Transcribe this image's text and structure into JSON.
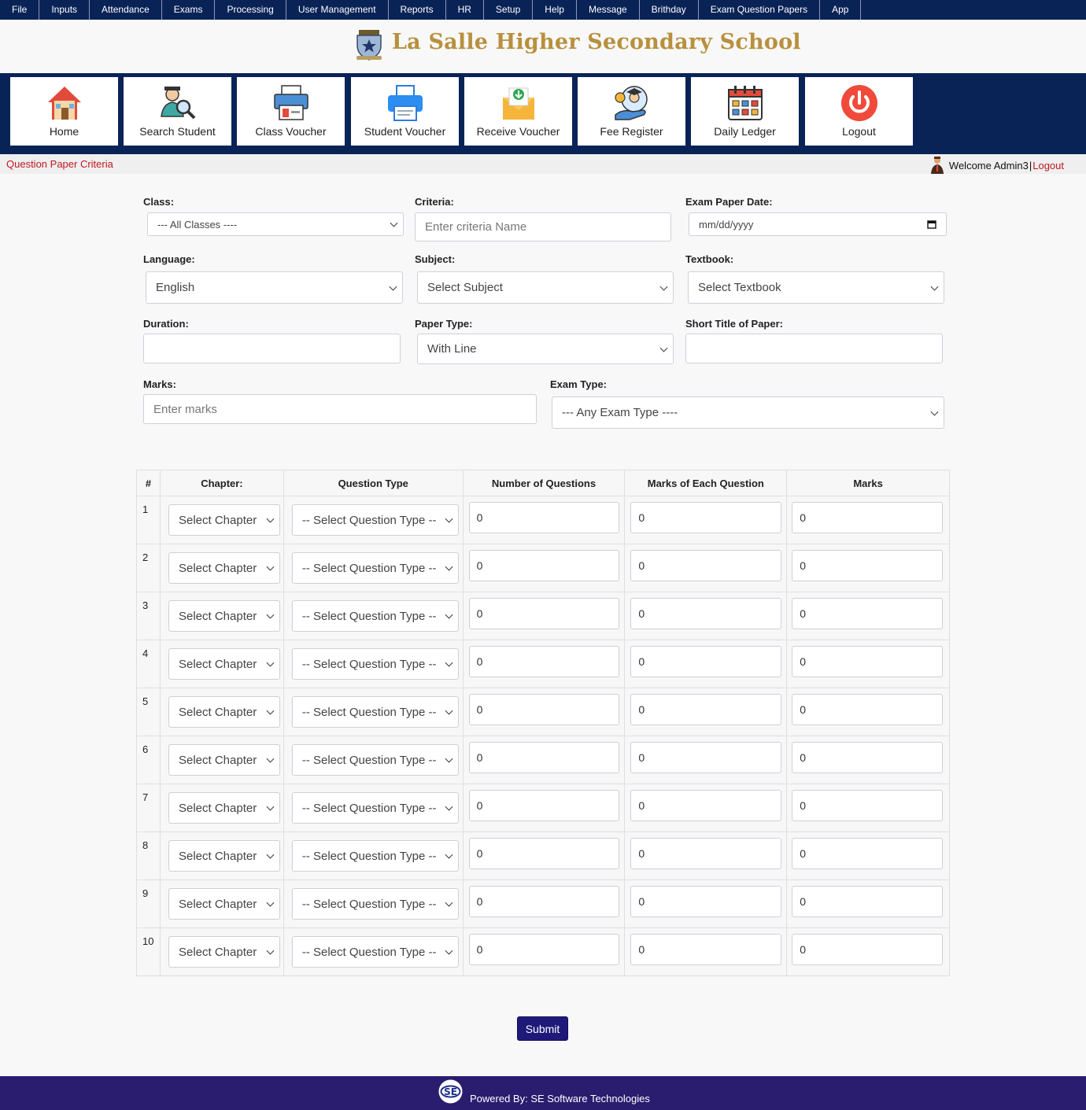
{
  "menu": [
    "File",
    "Inputs",
    "Attendance",
    "Exams",
    "Processing",
    "User Management",
    "Reports",
    "HR",
    "Setup",
    "Help",
    "Message",
    "Brithday",
    "Exam Question Papers",
    "App"
  ],
  "header": {
    "school_name": "La Salle Higher Secondary School"
  },
  "tiles": [
    {
      "label": "Home",
      "icon": "home-icon"
    },
    {
      "label": "Search Student",
      "icon": "search-student-icon"
    },
    {
      "label": "Class Voucher",
      "icon": "class-voucher-icon"
    },
    {
      "label": "Student Voucher",
      "icon": "printer-icon"
    },
    {
      "label": "Receive Voucher",
      "icon": "envelope-icon"
    },
    {
      "label": "Fee Register",
      "icon": "fee-register-icon"
    },
    {
      "label": "Daily Ledger",
      "icon": "calendar-icon"
    },
    {
      "label": "Logout",
      "icon": "power-icon"
    }
  ],
  "subheader": {
    "breadcrumb": "Question Paper Criteria",
    "welcome": "Welcome Admin3",
    "separator": "|",
    "logout": "Logout"
  },
  "form": {
    "class_label": "Class:",
    "class_value": "--- All Classes ----",
    "criteria_label": "Criteria:",
    "criteria_placeholder": "Enter criteria Name",
    "date_label": "Exam Paper Date:",
    "date_placeholder": "mm/dd/yyyy",
    "language_label": "Language:",
    "language_value": "English",
    "subject_label": "Subject:",
    "subject_value": "Select Subject",
    "textbook_label": "Textbook:",
    "textbook_value": "Select Textbook",
    "duration_label": "Duration:",
    "duration_value": "",
    "paper_type_label": "Paper Type:",
    "paper_type_value": "With Line",
    "short_title_label": "Short Title of Paper:",
    "short_title_value": "",
    "marks_label": "Marks:",
    "marks_placeholder": "Enter marks",
    "exam_type_label": "Exam Type:",
    "exam_type_value": "--- Any Exam Type ----"
  },
  "table": {
    "headers": [
      "#",
      "Chapter:",
      "Question Type",
      "Number of Questions",
      "Marks of Each Question",
      "Marks"
    ],
    "rows": [
      {
        "num": "1",
        "chapter": "Select Chapter",
        "qtype": "-- Select Question Type --",
        "nq": "0",
        "me": "0",
        "marks": "0"
      },
      {
        "num": "2",
        "chapter": "Select Chapter",
        "qtype": "-- Select Question Type --",
        "nq": "0",
        "me": "0",
        "marks": "0"
      },
      {
        "num": "3",
        "chapter": "Select Chapter",
        "qtype": "-- Select Question Type --",
        "nq": "0",
        "me": "0",
        "marks": "0"
      },
      {
        "num": "4",
        "chapter": "Select Chapter",
        "qtype": "-- Select Question Type --",
        "nq": "0",
        "me": "0",
        "marks": "0"
      },
      {
        "num": "5",
        "chapter": "Select Chapter",
        "qtype": "-- Select Question Type --",
        "nq": "0",
        "me": "0",
        "marks": "0"
      },
      {
        "num": "6",
        "chapter": "Select Chapter",
        "qtype": "-- Select Question Type --",
        "nq": "0",
        "me": "0",
        "marks": "0"
      },
      {
        "num": "7",
        "chapter": "Select Chapter",
        "qtype": "-- Select Question Type --",
        "nq": "0",
        "me": "0",
        "marks": "0"
      },
      {
        "num": "8",
        "chapter": "Select Chapter",
        "qtype": "-- Select Question Type --",
        "nq": "0",
        "me": "0",
        "marks": "0"
      },
      {
        "num": "9",
        "chapter": "Select Chapter",
        "qtype": "-- Select Question Type --",
        "nq": "0",
        "me": "0",
        "marks": "0"
      },
      {
        "num": "10",
        "chapter": "Select Chapter",
        "qtype": "-- Select Question Type --",
        "nq": "0",
        "me": "0",
        "marks": "0"
      }
    ]
  },
  "submit_label": "Submit",
  "footer": {
    "powered_by": "Powered By: SE Software Technologies"
  },
  "colors": {
    "navy": "#0a2357",
    "brand_gold": "#b8903e",
    "accent_red": "#c01820",
    "button": "#1f1a7a",
    "footer": "#2a1c6e"
  }
}
